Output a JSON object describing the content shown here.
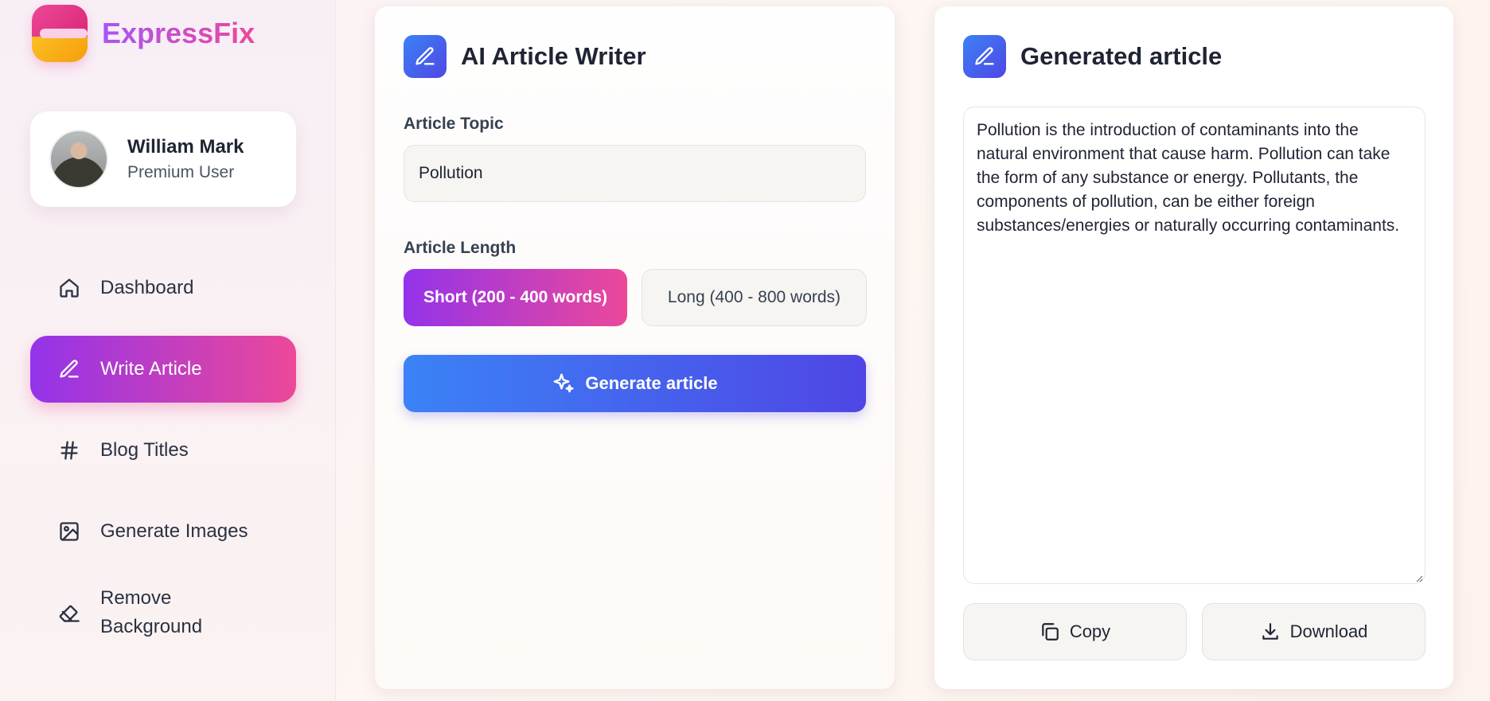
{
  "brand": {
    "name": "ExpressFix"
  },
  "user": {
    "name": "William Mark",
    "role": "Premium User"
  },
  "nav": {
    "items": [
      {
        "label": "Dashboard",
        "icon": "home-icon"
      },
      {
        "label": "Write Article",
        "icon": "pen-icon",
        "active": true
      },
      {
        "label": "Blog Titles",
        "icon": "hash-icon"
      },
      {
        "label": "Generate Images",
        "icon": "image-icon"
      },
      {
        "label": "Remove Background",
        "icon": "eraser-icon"
      }
    ]
  },
  "writer": {
    "title": "AI Article Writer",
    "topic_label": "Article Topic",
    "topic_value": "Pollution",
    "length_label": "Article Length",
    "length_options": [
      "Short (200 - 400 words)",
      "Long (400 - 800 words)"
    ],
    "selected_length": "Short (200 - 400 words)",
    "generate_label": "Generate article"
  },
  "output": {
    "title": "Generated article",
    "article": "Pollution is the introduction of contaminants into the natural environment that cause harm. Pollution can take the form of any substance or energy. Pollutants, the components of pollution, can be either foreign substances/energies or naturally occurring contaminants.",
    "copy_label": "Copy",
    "download_label": "Download"
  },
  "colors": {
    "accent_gradient_start": "#9333ea",
    "accent_gradient_end": "#ec4899",
    "primary_gradient_start": "#3b82f6",
    "primary_gradient_end": "#4f46e5"
  }
}
